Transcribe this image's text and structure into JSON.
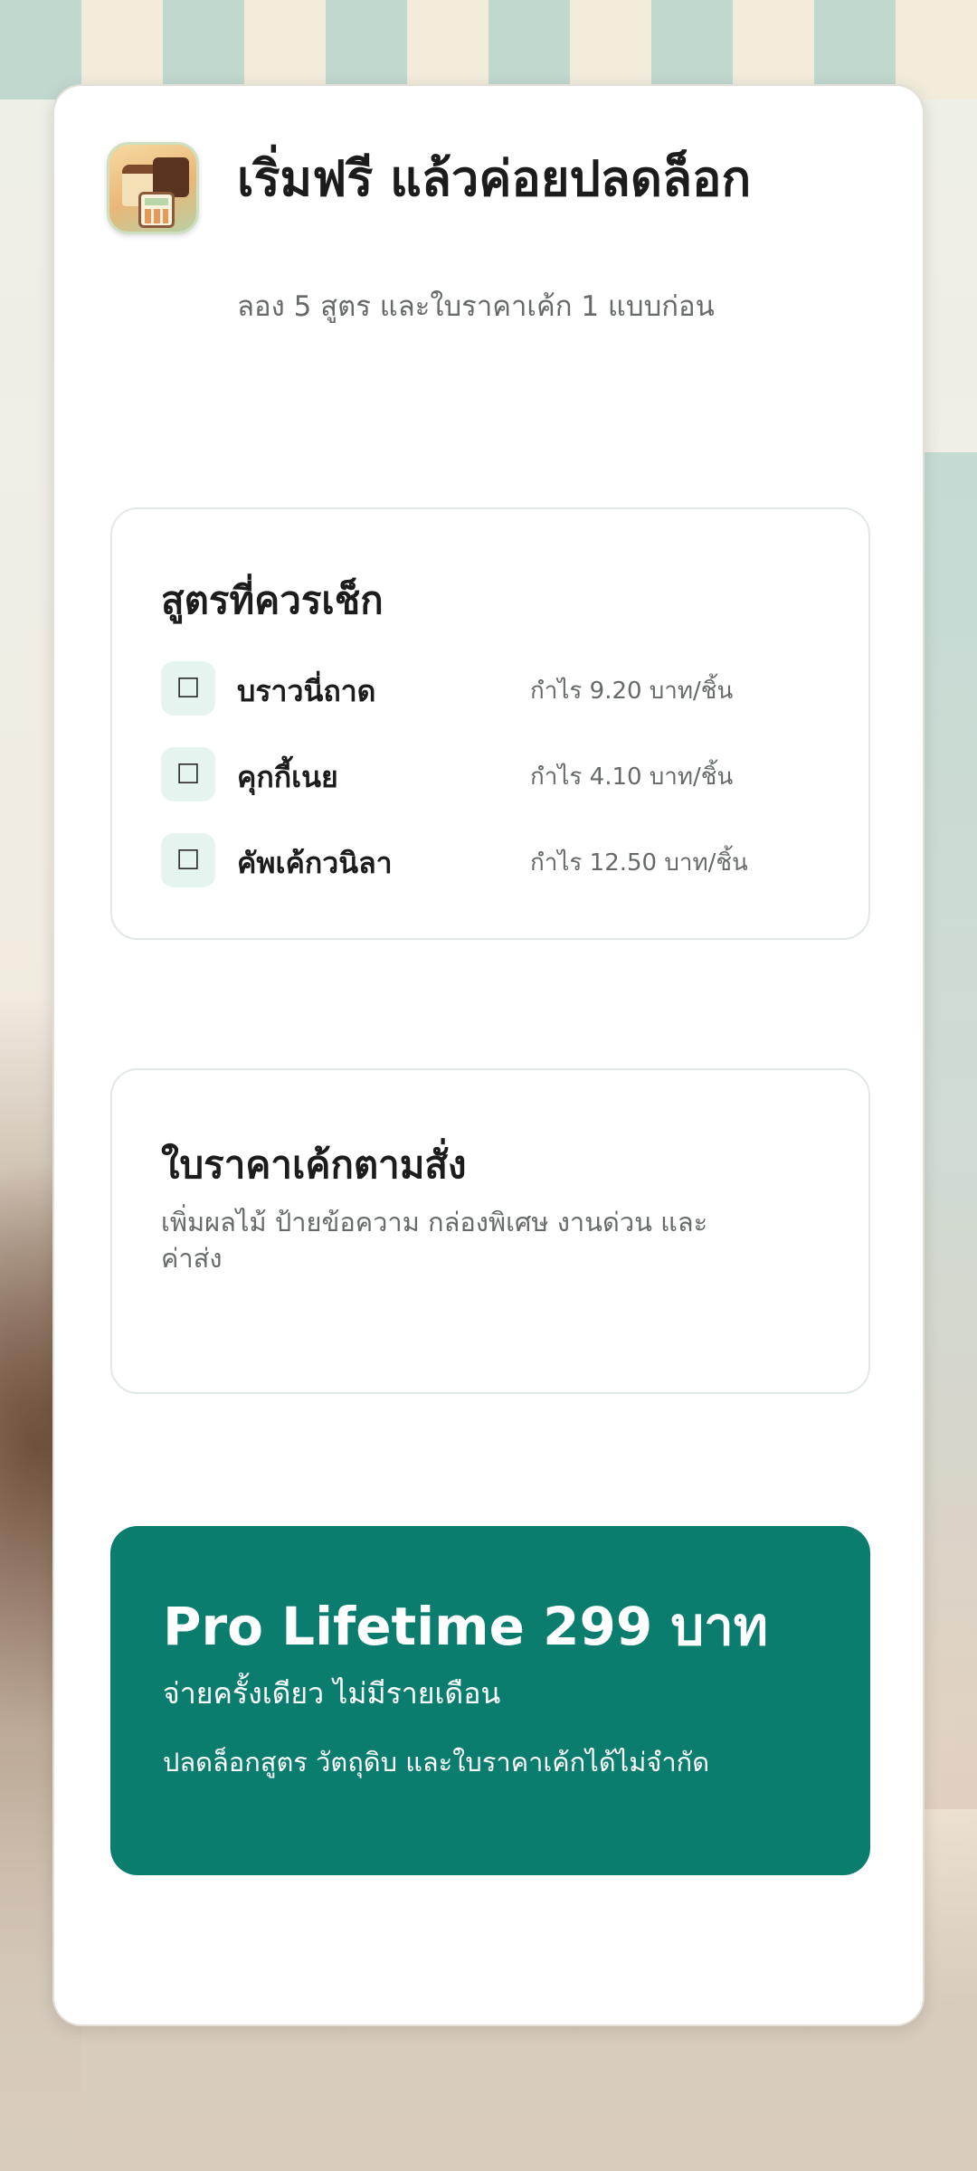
{
  "header": {
    "title": "เริ่มฟรี แล้วค่อยปลดล็อก",
    "subtitle": "ลอง 5 สูตร และใบราคาเค้ก 1 แบบก่อน"
  },
  "recipes": {
    "title": "สูตรที่ควรเช็ก",
    "items": [
      {
        "checkbox": "☐",
        "name": "บราวนี่ถาด",
        "profit": "กำไร 9.20 บาท/ชิ้น"
      },
      {
        "checkbox": "☐",
        "name": "คุกกี้เนย",
        "profit": "กำไร 4.10 บาท/ชิ้น"
      },
      {
        "checkbox": "☐",
        "name": "คัพเค้กวนิลา",
        "profit": "กำไร 12.50 บาท/ชิ้น"
      }
    ]
  },
  "quote": {
    "title": "ใบราคาเค้กตามสั่ง",
    "description": "เพิ่มผลไม้ ป้ายข้อความ กล่องพิเศษ งานด่วน และค่าส่ง"
  },
  "pro": {
    "title": "Pro Lifetime 299 บาท",
    "line1": "จ่ายครั้งเดียว ไม่มีรายเดือน",
    "line2": "ปลดล็อกสูตร วัตถุดิบ และใบราคาเค้กได้ไม่จำกัด",
    "color": "#0b7d6e"
  },
  "icons": {
    "app": "bakery-calculator-app-icon",
    "checkbox": "checkbox-icon"
  }
}
